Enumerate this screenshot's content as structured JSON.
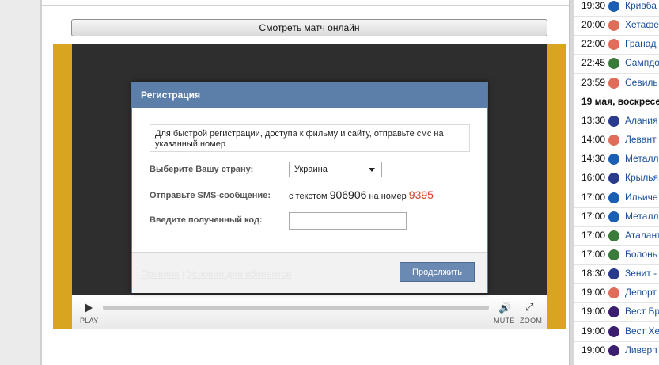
{
  "watch_button": "Смотреть матч онлайн",
  "player": {
    "play_label": "PLAY",
    "mute_label": "MUTE",
    "zoom_label": "ZOOM"
  },
  "dialog": {
    "title": "Регистрация",
    "info": "Для быстрой регистрации, доступа к фильму и сайту, отправьте смс на указанный номер",
    "country_label": "Выберите Вашу страну:",
    "country_value": "Украина",
    "sms_label": "Отправьте SMS-сообщение:",
    "sms_prefix": "с текстом",
    "sms_code": "906906",
    "sms_mid": "на номер",
    "sms_number": "9395",
    "code_label": "Введите полученный код:",
    "code_value": "",
    "rules_link": "Правила",
    "link_separator": "|",
    "terms_link": "Условия для абонентов",
    "continue_button": "Продолжить"
  },
  "sidebar": {
    "rows": [
      {
        "time": "19:30",
        "team": "Кривба",
        "icon": "ball-icon",
        "color": "#1a5fb4"
      },
      {
        "time": "20:00",
        "team": "Хетафе",
        "icon": "laliga-icon",
        "color": "#e06d5a"
      },
      {
        "time": "22:00",
        "team": "Гранад",
        "icon": "laliga-icon",
        "color": "#e06d5a"
      },
      {
        "time": "22:45",
        "team": "Сампдо",
        "icon": "ball-icon",
        "color": "#3a7a3a"
      },
      {
        "time": "23:59",
        "team": "Севиль",
        "icon": "laliga-icon",
        "color": "#e06d5a"
      },
      {
        "date": "19 мая, воскресе"
      },
      {
        "time": "13:30",
        "team": "Алания",
        "icon": "rfpl-icon",
        "color": "#2a3a8c"
      },
      {
        "time": "14:00",
        "team": "Левант",
        "icon": "laliga-icon",
        "color": "#e06d5a"
      },
      {
        "time": "14:30",
        "team": "Металл",
        "icon": "ball-icon",
        "color": "#1a5fb4"
      },
      {
        "time": "16:00",
        "team": "Крылья",
        "icon": "rfpl-icon",
        "color": "#2a3a8c"
      },
      {
        "time": "17:00",
        "team": "Ильиче",
        "icon": "ball-icon",
        "color": "#1a5fb4"
      },
      {
        "time": "17:00",
        "team": "Металл",
        "icon": "ball-icon",
        "color": "#1a5fb4"
      },
      {
        "time": "17:00",
        "team": "Аталанта",
        "icon": "seriea-icon",
        "color": "#3a7a3a"
      },
      {
        "time": "17:00",
        "team": "Болонь",
        "icon": "seriea-icon",
        "color": "#3a7a3a"
      },
      {
        "time": "18:30",
        "team": "Зенит -",
        "icon": "rfpl-icon",
        "color": "#2a3a8c"
      },
      {
        "time": "19:00",
        "team": "Депорт",
        "icon": "laliga-icon",
        "color": "#e06d5a"
      },
      {
        "time": "19:00",
        "team": "Вест Бр",
        "icon": "epl-icon",
        "color": "#3b1e6e"
      },
      {
        "time": "19:00",
        "team": "Вест Хе",
        "icon": "epl-icon",
        "color": "#3b1e6e"
      },
      {
        "time": "19:00",
        "team": "Ливерп",
        "icon": "epl-icon",
        "color": "#3b1e6e"
      }
    ]
  }
}
